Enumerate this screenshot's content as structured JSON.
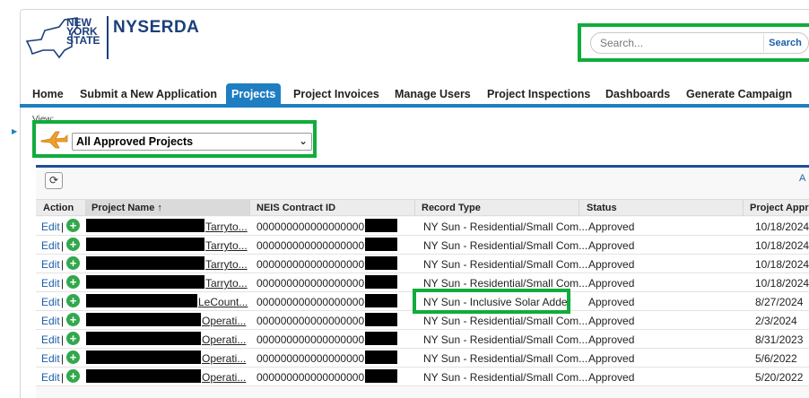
{
  "header": {
    "logo_text": "NEW\nYORK\nSTATE",
    "brand": "NYSERDA"
  },
  "search": {
    "placeholder": "Search...",
    "button_label": "Search"
  },
  "nav": {
    "tabs": [
      {
        "label": "Home",
        "active": false
      },
      {
        "label": "Submit a New Application",
        "active": false
      },
      {
        "label": "Projects",
        "active": true
      },
      {
        "label": "Project Invoices",
        "active": false
      },
      {
        "label": "Manage Users",
        "active": false
      },
      {
        "label": "Project Inspections",
        "active": false
      },
      {
        "label": "Dashboards",
        "active": false
      },
      {
        "label": "Generate Campaign",
        "active": false
      }
    ]
  },
  "view": {
    "label": "View:",
    "selected": "All Approved Projects",
    "icon": "airplane-icon"
  },
  "list": {
    "letter_link": "A",
    "columns": [
      "Action",
      "Project Name ↑",
      "NEIS Contract ID",
      "Record Type",
      "Status",
      "Project Appro"
    ],
    "rows": [
      {
        "edit": "Edit",
        "sep": "|",
        "project_suffix": "Tarryto...",
        "contract": "000000000000000000",
        "record_type": "NY Sun - Residential/Small Com...",
        "status": "Approved",
        "approved": "10/18/2024"
      },
      {
        "edit": "Edit",
        "sep": "|",
        "project_suffix": "Tarryto...",
        "contract": "000000000000000000",
        "record_type": "NY Sun - Residential/Small Com...",
        "status": "Approved",
        "approved": "10/18/2024"
      },
      {
        "edit": "Edit",
        "sep": "|",
        "project_suffix": "Tarryto...",
        "contract": "000000000000000000",
        "record_type": "NY Sun - Residential/Small Com...",
        "status": "Approved",
        "approved": "10/18/2024"
      },
      {
        "edit": "Edit",
        "sep": "|",
        "project_suffix": "Tarryto...",
        "contract": "000000000000000000",
        "record_type": "NY Sun - Residential/Small Com...",
        "status": "Approved",
        "approved": "10/18/2024"
      },
      {
        "edit": "Edit",
        "sep": "|",
        "project_suffix": "LeCount...",
        "contract": "000000000000000000",
        "record_type": "NY Sun - Inclusive Solar Adder",
        "status": "Approved",
        "approved": "8/27/2024"
      },
      {
        "edit": "Edit",
        "sep": "|",
        "project_suffix": "Operati...",
        "contract": "000000000000000000",
        "record_type": "NY Sun - Residential/Small Com...",
        "status": "Approved",
        "approved": "2/3/2024"
      },
      {
        "edit": "Edit",
        "sep": "|",
        "project_suffix": "Operati...",
        "contract": "000000000000000000",
        "record_type": "NY Sun - Residential/Small Com...",
        "status": "Approved",
        "approved": "8/31/2023"
      },
      {
        "edit": "Edit",
        "sep": "|",
        "project_suffix": "Operati...",
        "contract": "000000000000000000",
        "record_type": "NY Sun - Residential/Small Com...",
        "status": "Approved",
        "approved": "5/6/2022"
      },
      {
        "edit": "Edit",
        "sep": "|",
        "project_suffix": "Operati...",
        "contract": "000000000000000000",
        "record_type": "NY Sun - Residential/Small Com...",
        "status": "Approved",
        "approved": "5/20/2022"
      }
    ]
  },
  "colors": {
    "brand_blue": "#1c3f7a",
    "tab_blue": "#1f7ec2",
    "highlight_green": "#10ac3c",
    "add_green": "#32a84c"
  }
}
